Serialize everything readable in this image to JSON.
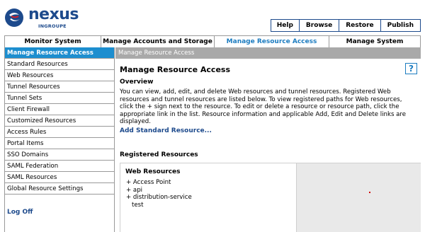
{
  "logo": {
    "name": "nexus",
    "sub": "INGROUPE"
  },
  "top_buttons": [
    "Help",
    "Browse",
    "Restore",
    "Publish"
  ],
  "nav_tabs": [
    {
      "label": "Monitor System"
    },
    {
      "label": "Manage Accounts and Storage"
    },
    {
      "label": "Manage Resource Access",
      "active": true
    },
    {
      "label": "Manage System"
    }
  ],
  "sidebar": {
    "items": [
      {
        "label": "Manage Resource Access",
        "active": true
      },
      {
        "label": "Standard Resources"
      },
      {
        "label": "Web Resources"
      },
      {
        "label": "Tunnel Resources"
      },
      {
        "label": "Tunnel Sets"
      },
      {
        "label": "Client Firewall"
      },
      {
        "label": "Customized Resources"
      },
      {
        "label": "Access Rules"
      },
      {
        "label": "Portal Items"
      },
      {
        "label": "SSO Domains"
      },
      {
        "label": "SAML Federation"
      },
      {
        "label": "SAML Resources"
      },
      {
        "label": "Global Resource Settings"
      }
    ],
    "logoff": "Log Off"
  },
  "main": {
    "breadcrumb": "Manage Resource Access",
    "title": "Manage Resource Access",
    "overview_heading": "Overview",
    "overview_text": "You can view, add, edit, and delete Web resources and tunnel resources. Registered Web resources and tunnel resources are listed below. To view registered paths for Web resources, click the + sign next to the resource. To edit or delete a resource or resource path, click the appropriate link in the list. Resource information and applicable Add, Edit and Delete links are displayed.",
    "add_link": "Add Standard Resource...",
    "registered_heading": "Registered Resources",
    "web_resources_heading": "Web Resources",
    "resources": [
      "+ Access Point",
      "+ api",
      "+ distribution-service",
      "test"
    ]
  },
  "colors": {
    "brand": "#1d4a8c",
    "accent": "#1d8ecf",
    "active_tab_text": "#1c7cc0",
    "breadcrumb_bg": "#a9a9a9"
  }
}
